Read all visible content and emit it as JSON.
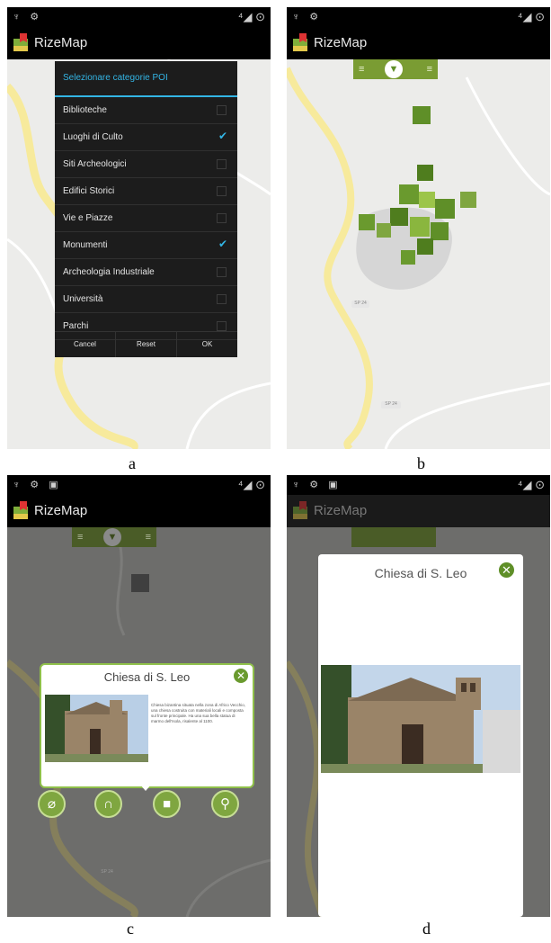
{
  "app": {
    "title": "RizeMap",
    "statusbar_left_a": "♆ ⚙",
    "statusbar_left_c": "♆ ⚙ ▣",
    "statusbar_right": "⁴◢ ⊙"
  },
  "panel_a": {
    "caption": "a",
    "dialog_title": "Selezionare categorie POI",
    "categories": [
      {
        "label": "Biblioteche",
        "checked": false
      },
      {
        "label": "Luoghi di Culto",
        "checked": true
      },
      {
        "label": "Siti Archeologici",
        "checked": false
      },
      {
        "label": "Edifici Storici",
        "checked": false
      },
      {
        "label": "Vie e Piazze",
        "checked": false
      },
      {
        "label": "Monumenti",
        "checked": true
      },
      {
        "label": "Archeologia Industriale",
        "checked": false
      },
      {
        "label": "Università",
        "checked": false
      },
      {
        "label": "Parchi",
        "checked": false
      }
    ],
    "buttons": {
      "cancel": "Cancel",
      "reset": "Reset",
      "ok": "OK"
    }
  },
  "panel_b": {
    "caption": "b",
    "road_label_1": "SP 24",
    "road_label_2": "SP 24"
  },
  "panel_c": {
    "caption": "c",
    "popup_title": "Chiesa di S. Leo",
    "popup_description": "Chiesa bizantina situata nella zona di Africo Vecchio, una chiesa costruita con materiali locali e composta sul fronte principale. Ha una sua bella statua di marmo dell'Isola, risalente al 1100.",
    "road_label": "SP 24",
    "buttons": [
      "paperclip-icon",
      "headphones-icon",
      "video-camera-icon",
      "magnifier-icon"
    ]
  },
  "panel_d": {
    "caption": "d",
    "card_title": "Chiesa di S. Leo"
  },
  "colors": {
    "accent_blue": "#33b5e5",
    "poi_green": "#5f8f28",
    "road_yellow": "#f7ea9c",
    "map_gray": "#ececea",
    "dim_overlay": "rgba(0,0,0,0.55)"
  }
}
